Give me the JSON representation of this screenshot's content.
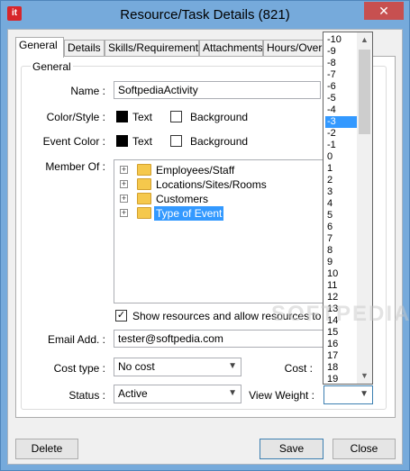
{
  "window": {
    "title": "Resource/Task Details (821)",
    "app_icon_text": "it",
    "close_glyph": "✕"
  },
  "tabs": [
    {
      "label": "General"
    },
    {
      "label": "Details"
    },
    {
      "label": "Skills/Requirements"
    },
    {
      "label": "Attachments"
    },
    {
      "label": "Hours/Over E"
    }
  ],
  "group": {
    "label": "General"
  },
  "form": {
    "name_label": "Name :",
    "name_value": "SoftpediaActivity",
    "color_style_label": "Color/Style :",
    "event_color_label": "Event Color :",
    "text_label": "Text",
    "background_label": "Background",
    "member_of_label": "Member Of :",
    "show_resources_label": "Show resources and allow resources to be lin",
    "show_resources_checked": true,
    "email_label": "Email Add. :",
    "email_value": "tester@softpedia.com",
    "cost_type_label": "Cost type :",
    "cost_type_value": "No cost",
    "cost_label": "Cost :",
    "status_label": "Status :",
    "status_value": "Active",
    "view_weight_label": "View Weight :",
    "view_weight_value": ""
  },
  "tree": [
    {
      "label": "Employees/Staff",
      "selected": false
    },
    {
      "label": "Locations/Sites/Rooms",
      "selected": false
    },
    {
      "label": "Customers",
      "selected": false
    },
    {
      "label": "Type of Event",
      "selected": true
    }
  ],
  "dropdown": {
    "items": [
      "-10",
      "-9",
      "-8",
      "-7",
      "-6",
      "-5",
      "-4",
      "-3",
      "-2",
      "-1",
      "0",
      "1",
      "2",
      "3",
      "4",
      "5",
      "6",
      "7",
      "8",
      "9",
      "10",
      "11",
      "12",
      "13",
      "14",
      "15",
      "16",
      "17",
      "18",
      "19"
    ],
    "selected": "-3"
  },
  "buttons": {
    "delete": "Delete",
    "save": "Save",
    "close": "Close"
  },
  "watermark": "SOFTPEDIA",
  "colors": {
    "titlebar": "#76aadb",
    "close_button": "#c75050",
    "selection": "#3399ff",
    "folder": "#f5c84c"
  }
}
